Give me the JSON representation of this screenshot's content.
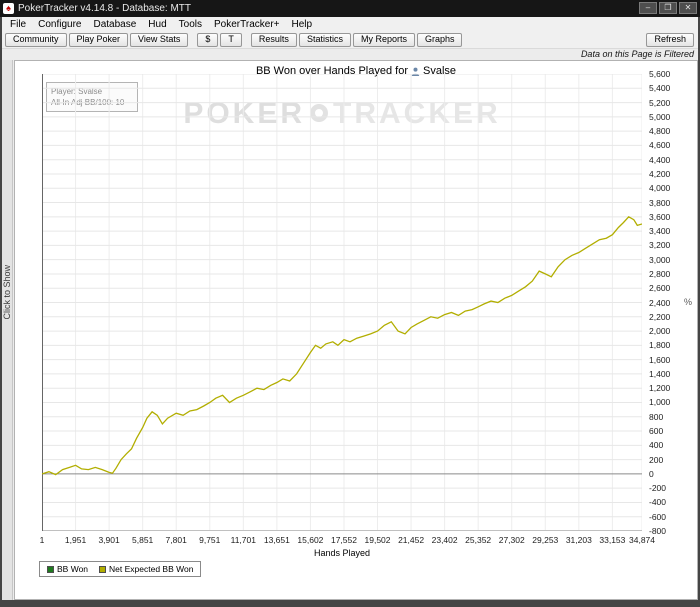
{
  "window": {
    "title": "PokerTracker v4.14.8 - Database: MTT",
    "controls": {
      "minimize": "–",
      "maximize": "❐",
      "close": "✕"
    },
    "app_icon_glyph": "♠"
  },
  "menu": {
    "items": [
      "File",
      "Configure",
      "Database",
      "Hud",
      "Tools",
      "PokerTracker+",
      "Help"
    ]
  },
  "toolbar": {
    "group1": [
      "Community",
      "Play Poker",
      "View Stats"
    ],
    "group2": [
      "$",
      "T"
    ],
    "group3": [
      "Results",
      "Statistics",
      "My Reports",
      "Graphs"
    ],
    "refresh_label": "Refresh"
  },
  "filter_notice": "Data on this Page is Filtered",
  "left_panel_handle": "Click to Show",
  "watermark": {
    "left": "POKER",
    "right": "TRACKER"
  },
  "chart": {
    "title_prefix": "BB Won over Hands Played for",
    "player_name": "Svalse",
    "info_box": {
      "line1": "Player: Svalse",
      "line2": "All-In Adj BB/100: 10"
    },
    "x_axis_label": "Hands Played",
    "y_axis_unit": "%",
    "legend": [
      {
        "label": "BB Won",
        "color": "#1e7a1e"
      },
      {
        "label": "Net Expected BB Won",
        "color": "#b2ae00"
      }
    ]
  },
  "chart_data": {
    "type": "line",
    "title": "BB Won over Hands Played for Svalse",
    "xlabel": "Hands Played",
    "ylabel": "BB Won",
    "xlim": [
      1,
      34874
    ],
    "ylim": [
      -800,
      5600
    ],
    "grid": true,
    "legend_position": "bottom-left",
    "legend": [
      "BB Won",
      "Net Expected BB Won"
    ],
    "x_ticks": {
      "values": [
        1,
        1951,
        3901,
        5851,
        7801,
        9751,
        11701,
        13651,
        15602,
        17552,
        19502,
        21452,
        23402,
        25352,
        27302,
        29253,
        31203,
        33153,
        34874
      ],
      "labels": [
        "1",
        "1,951",
        "3,901",
        "5,851",
        "7,801",
        "9,751",
        "11,701",
        "13,651",
        "15,602",
        "17,552",
        "19,502",
        "21,452",
        "23,402",
        "25,352",
        "27,302",
        "29,253",
        "31,203",
        "33,153",
        "34,874"
      ]
    },
    "y_ticks": {
      "min": -800,
      "max": 5600,
      "step": 200
    },
    "series": [
      {
        "name": "Net Expected BB Won",
        "color": "#b2ae00",
        "x": [
          1,
          400,
          800,
          1200,
          1600,
          1951,
          2300,
          2700,
          3100,
          3500,
          3901,
          4100,
          4300,
          4600,
          4900,
          5200,
          5500,
          5851,
          6100,
          6400,
          6700,
          7000,
          7300,
          7801,
          8200,
          8600,
          9000,
          9400,
          9751,
          10100,
          10500,
          10900,
          11300,
          11701,
          12100,
          12500,
          12900,
          13300,
          13651,
          14000,
          14400,
          14800,
          15200,
          15602,
          15900,
          16200,
          16500,
          16900,
          17200,
          17552,
          17900,
          18300,
          18700,
          19100,
          19502,
          19900,
          20300,
          20700,
          21100,
          21452,
          21800,
          22200,
          22600,
          23000,
          23402,
          23800,
          24200,
          24600,
          25000,
          25352,
          25700,
          26100,
          26500,
          26900,
          27302,
          27700,
          28100,
          28500,
          28900,
          29253,
          29600,
          30000,
          30400,
          30800,
          31203,
          31600,
          32000,
          32400,
          32800,
          33153,
          33500,
          33800,
          34100,
          34400,
          34600,
          34874
        ],
        "y": [
          0,
          30,
          -10,
          60,
          90,
          120,
          70,
          60,
          90,
          60,
          20,
          10,
          80,
          200,
          280,
          350,
          500,
          650,
          780,
          870,
          820,
          700,
          780,
          850,
          820,
          880,
          900,
          950,
          1000,
          1060,
          1100,
          1000,
          1060,
          1100,
          1150,
          1200,
          1180,
          1240,
          1280,
          1330,
          1300,
          1400,
          1550,
          1700,
          1800,
          1760,
          1820,
          1850,
          1800,
          1880,
          1850,
          1900,
          1930,
          1960,
          2000,
          2080,
          2130,
          2000,
          1960,
          2050,
          2100,
          2150,
          2200,
          2180,
          2230,
          2260,
          2220,
          2280,
          2300,
          2340,
          2380,
          2420,
          2400,
          2460,
          2500,
          2560,
          2620,
          2700,
          2840,
          2800,
          2760,
          2900,
          3000,
          3060,
          3100,
          3160,
          3220,
          3280,
          3300,
          3350,
          3450,
          3520,
          3600,
          3560,
          3480,
          3500
        ]
      },
      {
        "name": "BB Won",
        "color": "#1e7a1e"
      }
    ]
  }
}
